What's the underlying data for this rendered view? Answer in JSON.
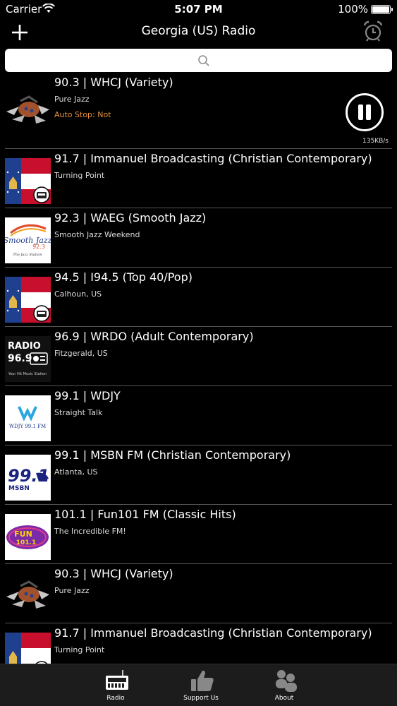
{
  "status": {
    "carrier": "Carrier",
    "time": "5:07 PM",
    "battery": "100%"
  },
  "navbar": {
    "title": "Georgia (US) Radio"
  },
  "search": {
    "placeholder": "",
    "value": ""
  },
  "stations": [
    {
      "title": "90.3 | WHCJ (Variety)",
      "subtitle": "Pure Jazz",
      "logo": "whcj-logo"
    },
    {
      "title": "91.7 | Immanuel Broadcasting (Christian Contemporary)",
      "subtitle": "Turning Point",
      "logo": "georgia-flag-logo"
    },
    {
      "title": "92.3 | WAEG (Smooth Jazz)",
      "subtitle": "Smooth Jazz Weekend",
      "logo": "smooth-jazz-logo"
    },
    {
      "title": "94.5 | I94.5 (Top 40/Pop)",
      "subtitle": "Calhoun, US",
      "logo": "georgia-flag-logo"
    },
    {
      "title": "96.9 | WRDO (Adult Contemporary)",
      "subtitle": "Fitzgerald, US",
      "logo": "radio-969-logo"
    },
    {
      "title": "99.1 | WDJY",
      "subtitle": "Straight Talk",
      "logo": "wdjy-logo"
    },
    {
      "title": "99.1 | MSBN FM (Christian Contemporary)",
      "subtitle": "Atlanta, US",
      "logo": "msbn-logo"
    },
    {
      "title": "101.1 | Fun101 FM (Classic Hits)",
      "subtitle": "The Incredible FM!",
      "logo": "fun101-logo"
    },
    {
      "title": "90.3 | WHCJ (Variety)",
      "subtitle": "Pure Jazz",
      "logo": "whcj-logo"
    },
    {
      "title": "91.7 | Immanuel Broadcasting (Christian Contemporary)",
      "subtitle": "Turning Point",
      "logo": "georgia-flag-logo"
    }
  ],
  "now_playing": {
    "auto_stop": "Auto Stop: Not",
    "bitrate": "135KB/s"
  },
  "logo_text": {
    "smooth_jazz": "Smooth Jazz",
    "smooth_jazz_freq": "92.3",
    "smooth_jazz_tag": "The Jazz Station",
    "radio_969": "RADIO",
    "radio_969_freq": "96.9",
    "radio_969_tag": "Your Hit Music Station",
    "wdjy": "WDJY 99.1 FM",
    "msbn": "99.1",
    "msbn_sub": "MSBN",
    "fun101": "FUN",
    "fun101_freq": "101.1"
  },
  "tabs": [
    {
      "label": "Radio",
      "icon": "radio-icon"
    },
    {
      "label": "Support Us",
      "icon": "thumbs-up-icon"
    },
    {
      "label": "About",
      "icon": "people-icon"
    }
  ],
  "colors": {
    "accent": "#e8913a",
    "background": "#000000",
    "tabbar": "#1c1c1c"
  }
}
